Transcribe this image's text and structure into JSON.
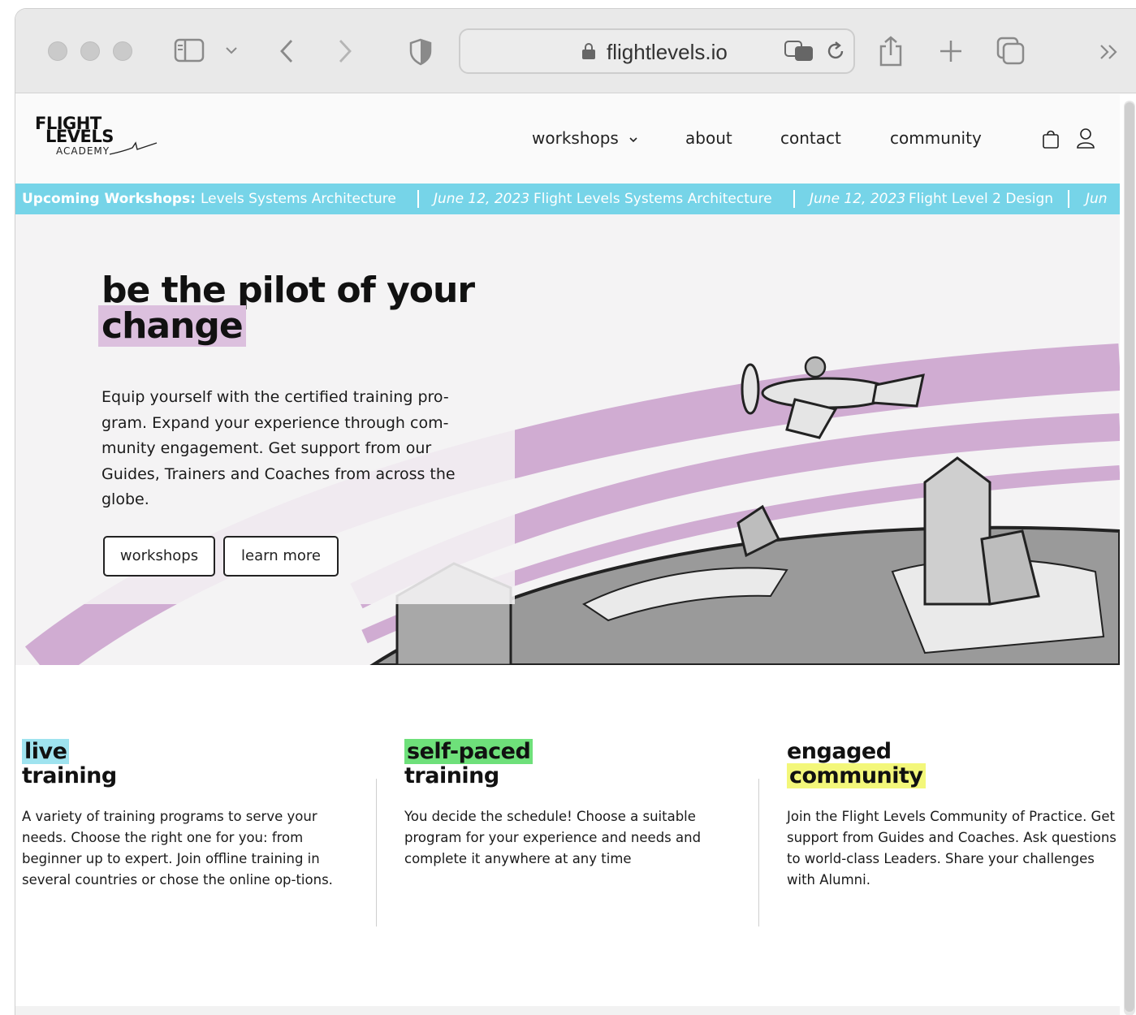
{
  "browser": {
    "url": "flightlevels.io"
  },
  "site": {
    "logo": {
      "line1": "FLIGHT",
      "line2": "LEVELS",
      "line3": "ACADEMY"
    },
    "nav": [
      {
        "label": "workshops",
        "has_dropdown": true
      },
      {
        "label": "about"
      },
      {
        "label": "contact"
      },
      {
        "label": "community"
      }
    ]
  },
  "ticker": {
    "lead": "Upcoming Workshops:",
    "items": [
      {
        "date": "",
        "title": "Levels Systems Architecture"
      },
      {
        "date": "June 12, 2023",
        "title": "Flight Levels Systems Architecture"
      },
      {
        "date": "June 12, 2023",
        "title": "Flight Level 2 Design"
      },
      {
        "date": "Jun",
        "title": ""
      }
    ],
    "color": "#76d4e8"
  },
  "hero": {
    "title_line1": "be the pilot of your",
    "title_line2": "change",
    "text": "Equip yourself with the certified training pro-gram. Expand your experience through com-munity engagement. Get support from our Guides, Trainers and Coaches from across the globe.",
    "buttons": [
      "workshops",
      "learn more"
    ],
    "highlight_color": "#dcc0de"
  },
  "features": [
    {
      "title_line1": "live",
      "title_line2": "training",
      "highlight_line": 1,
      "highlight_color": "#9fe3ef",
      "text": "A variety of training programs to serve your needs. Choose the right one for you: from beginner up to expert. Join offline training in several countries or chose the online op-tions."
    },
    {
      "title_line1": "self-paced",
      "title_line2": "training",
      "highlight_line": 1,
      "highlight_color": "#6ee07a",
      "text": "You decide the schedule! Choose a suitable program for your experience and needs and complete it anywhere at any time"
    },
    {
      "title_line1": "engaged",
      "title_line2": "community",
      "highlight_line": 2,
      "highlight_color": "#f3f77a",
      "text": "Join the Flight Levels Community of Practice. Get support from Guides and Coaches. Ask questions to world-class Leaders. Share your challenges with Alumni."
    }
  ]
}
